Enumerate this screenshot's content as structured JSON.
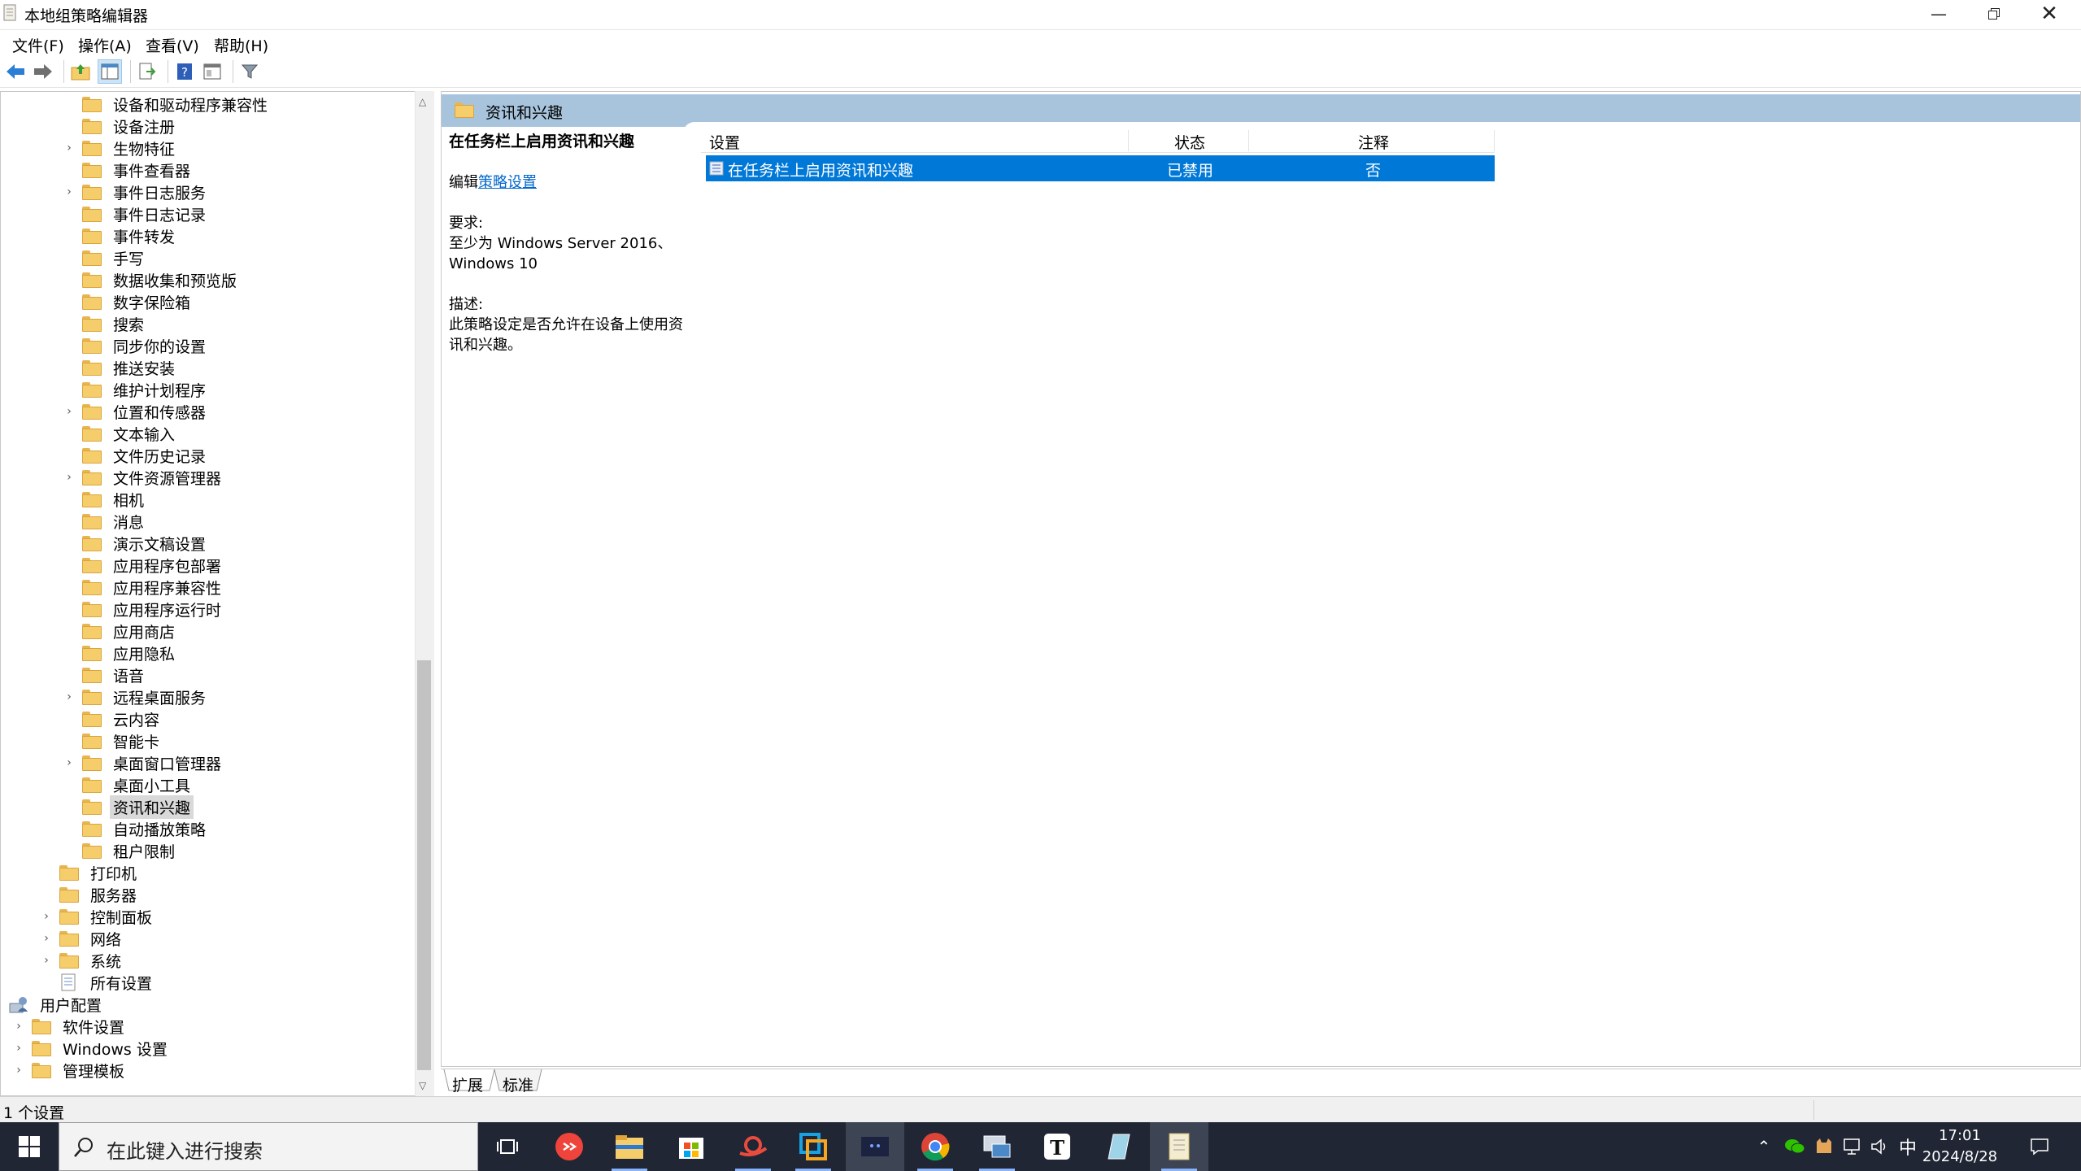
{
  "window": {
    "title": "本地组策略编辑器",
    "minimize_icon": "minimize-icon",
    "restore_icon": "restore-icon",
    "close_icon": "close-icon"
  },
  "menu": [
    {
      "label": "文件(F)"
    },
    {
      "label": "操作(A)"
    },
    {
      "label": "查看(V)"
    },
    {
      "label": "帮助(H)"
    }
  ],
  "toolbar": {
    "icons": [
      "back-arrow-icon",
      "forward-arrow-icon",
      "up-folder-icon",
      "show-hide-tree-icon",
      "export-list-icon",
      "help-icon",
      "properties-icon",
      "filter-icon"
    ]
  },
  "tree": {
    "items": [
      {
        "label": "设备和驱动程序兼容性"
      },
      {
        "label": "设备注册"
      },
      {
        "label": "生物特征"
      },
      {
        "label": "事件查看器"
      },
      {
        "label": "事件日志服务"
      },
      {
        "label": "事件日志记录"
      },
      {
        "label": "事件转发"
      },
      {
        "label": "手写"
      },
      {
        "label": "数据收集和预览版"
      },
      {
        "label": "数字保险箱"
      },
      {
        "label": "搜索"
      },
      {
        "label": "同步你的设置"
      },
      {
        "label": "推送安装"
      },
      {
        "label": "维护计划程序"
      },
      {
        "label": "位置和传感器"
      },
      {
        "label": "文本输入"
      },
      {
        "label": "文件历史记录"
      },
      {
        "label": "文件资源管理器"
      },
      {
        "label": "相机"
      },
      {
        "label": "消息"
      },
      {
        "label": "演示文稿设置"
      },
      {
        "label": "应用程序包部署"
      },
      {
        "label": "应用程序兼容性"
      },
      {
        "label": "应用程序运行时"
      },
      {
        "label": "应用商店"
      },
      {
        "label": "应用隐私"
      },
      {
        "label": "语音"
      },
      {
        "label": "远程桌面服务"
      },
      {
        "label": "云内容"
      },
      {
        "label": "智能卡"
      },
      {
        "label": "桌面窗口管理器"
      },
      {
        "label": "桌面小工具"
      },
      {
        "label": "资讯和兴趣"
      },
      {
        "label": "自动播放策略"
      },
      {
        "label": "租户限制"
      },
      {
        "label": "打印机"
      },
      {
        "label": "服务器"
      },
      {
        "label": "控制面板"
      },
      {
        "label": "网络"
      },
      {
        "label": "系统"
      },
      {
        "label": "所有设置"
      },
      {
        "label": "用户配置"
      },
      {
        "label": "软件设置"
      },
      {
        "label": "Windows 设置"
      },
      {
        "label": "管理模板"
      }
    ]
  },
  "details": {
    "header": "资讯和兴趣",
    "policy_title": "在任务栏上启用资讯和兴趣",
    "edit_prefix": "编辑",
    "edit_link": "策略设置",
    "requirement_label": "要求:",
    "requirement_text": "至少为 Windows Server 2016、Windows 10",
    "description_label": "描述:",
    "description_text": "此策略设定是否允许在设备上使用资讯和兴趣。"
  },
  "list": {
    "columns": [
      "设置",
      "状态",
      "注释"
    ],
    "rows": [
      {
        "setting": "在任务栏上启用资讯和兴趣",
        "state": "已禁用",
        "comment": "否"
      }
    ]
  },
  "bottom_tabs": [
    "扩展",
    "标准"
  ],
  "status_bar": {
    "text": "1 个设置"
  },
  "taskbar": {
    "search_placeholder": "在此键入进行搜索",
    "apps": [
      "task-view-icon",
      "anydesk-icon",
      "file-explorer-icon",
      "microsoft-store-icon",
      "snail-app-icon",
      "remote-desktop-icon",
      "terminal-app-icon",
      "chrome-icon",
      "network-admin-icon",
      "typora-icon",
      "notes-app-icon",
      "policy-editor-icon"
    ],
    "tray_icons": [
      "chevron-up-icon",
      "wechat-icon",
      "cat-app-icon",
      "network-icon",
      "volume-icon"
    ],
    "ime": "中",
    "time": "17:01",
    "date": "2024/8/28",
    "notification_icon": "notification-icon"
  },
  "colors": {
    "selection": "#0078d7",
    "header_band": "#a8c4dd",
    "taskbar": "#202634"
  }
}
